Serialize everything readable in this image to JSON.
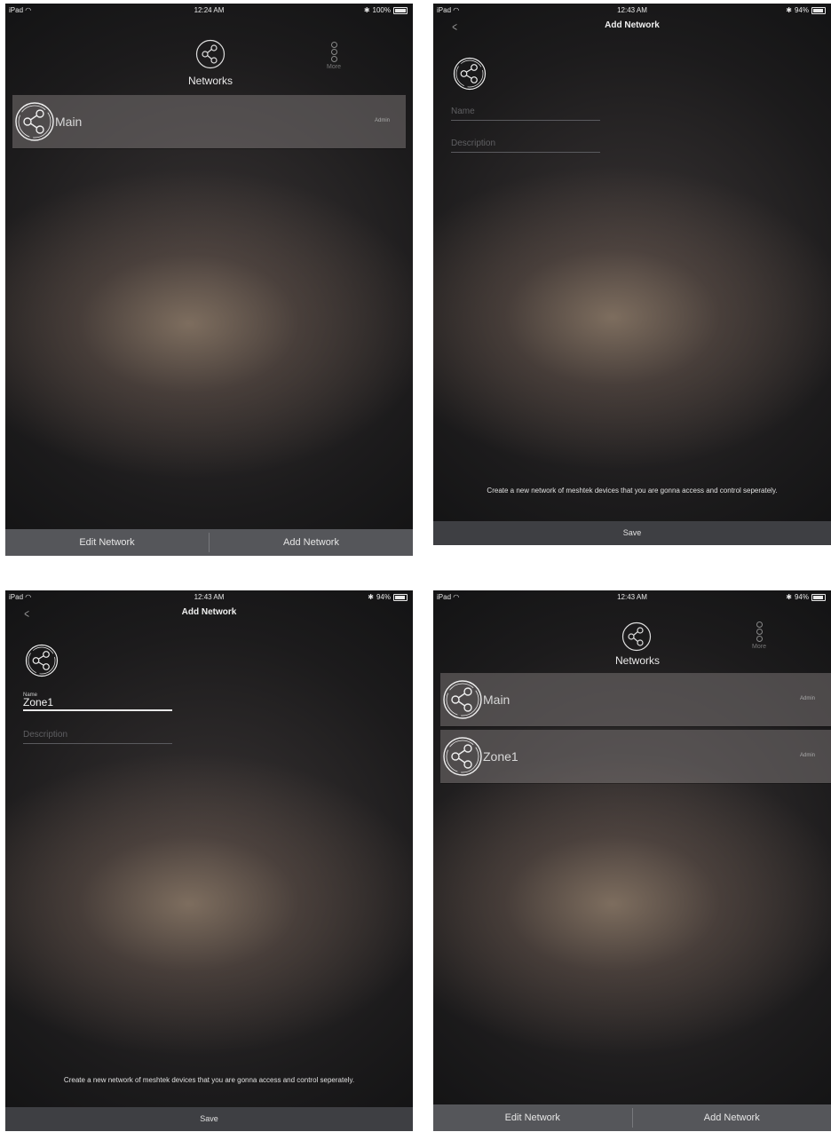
{
  "screens": [
    {
      "status": {
        "device": "iPad",
        "time": "12:24 AM",
        "battery": "100%"
      },
      "header": {
        "title": "Networks",
        "more_label": "More"
      },
      "networks": [
        {
          "name": "Main",
          "role": "Admin"
        }
      ],
      "bottom_bar": {
        "edit": "Edit Network",
        "add": "Add Network"
      }
    },
    {
      "status": {
        "device": "iPad",
        "time": "12:43 AM",
        "battery": "94%"
      },
      "title": "Add Network",
      "form": {
        "name_placeholder": "Name",
        "description_placeholder": "Description"
      },
      "hint": "Create a new network of meshtek devices that you are gonna access and control seperately.",
      "save_label": "Save"
    },
    {
      "status": {
        "device": "iPad",
        "time": "12:43 AM",
        "battery": "94%"
      },
      "title": "Add Network",
      "form": {
        "name_label": "Name",
        "name_value": "Zone1",
        "description_placeholder": "Description"
      },
      "hint": "Create a new network of meshtek devices that you are gonna access and control seperately.",
      "save_label": "Save"
    },
    {
      "status": {
        "device": "iPad",
        "time": "12:43 AM",
        "battery": "94%"
      },
      "header": {
        "title": "Networks",
        "more_label": "More"
      },
      "networks": [
        {
          "name": "Main",
          "role": "Admin"
        },
        {
          "name": "Zone1",
          "role": "Admin"
        }
      ],
      "bottom_bar": {
        "edit": "Edit Network",
        "add": "Add Network"
      }
    }
  ]
}
